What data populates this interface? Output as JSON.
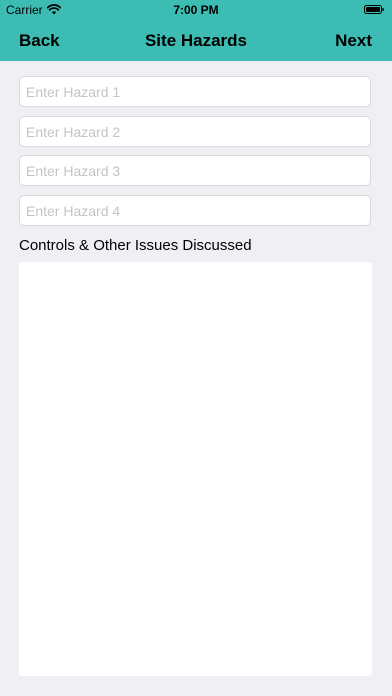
{
  "status_bar": {
    "carrier": "Carrier",
    "time": "7:00 PM",
    "wifi_icon": "wifi-icon",
    "battery_icon": "battery-icon"
  },
  "nav": {
    "back_label": "Back",
    "title": "Site Hazards",
    "next_label": "Next",
    "background_color": "#3dbcb4"
  },
  "hazards": [
    {
      "value": "",
      "placeholder": "Enter Hazard 1"
    },
    {
      "value": "",
      "placeholder": "Enter Hazard 2"
    },
    {
      "value": "",
      "placeholder": "Enter Hazard 3"
    },
    {
      "value": "",
      "placeholder": "Enter Hazard 4"
    }
  ],
  "controls": {
    "label": "Controls & Other Issues Discussed",
    "value": ""
  }
}
